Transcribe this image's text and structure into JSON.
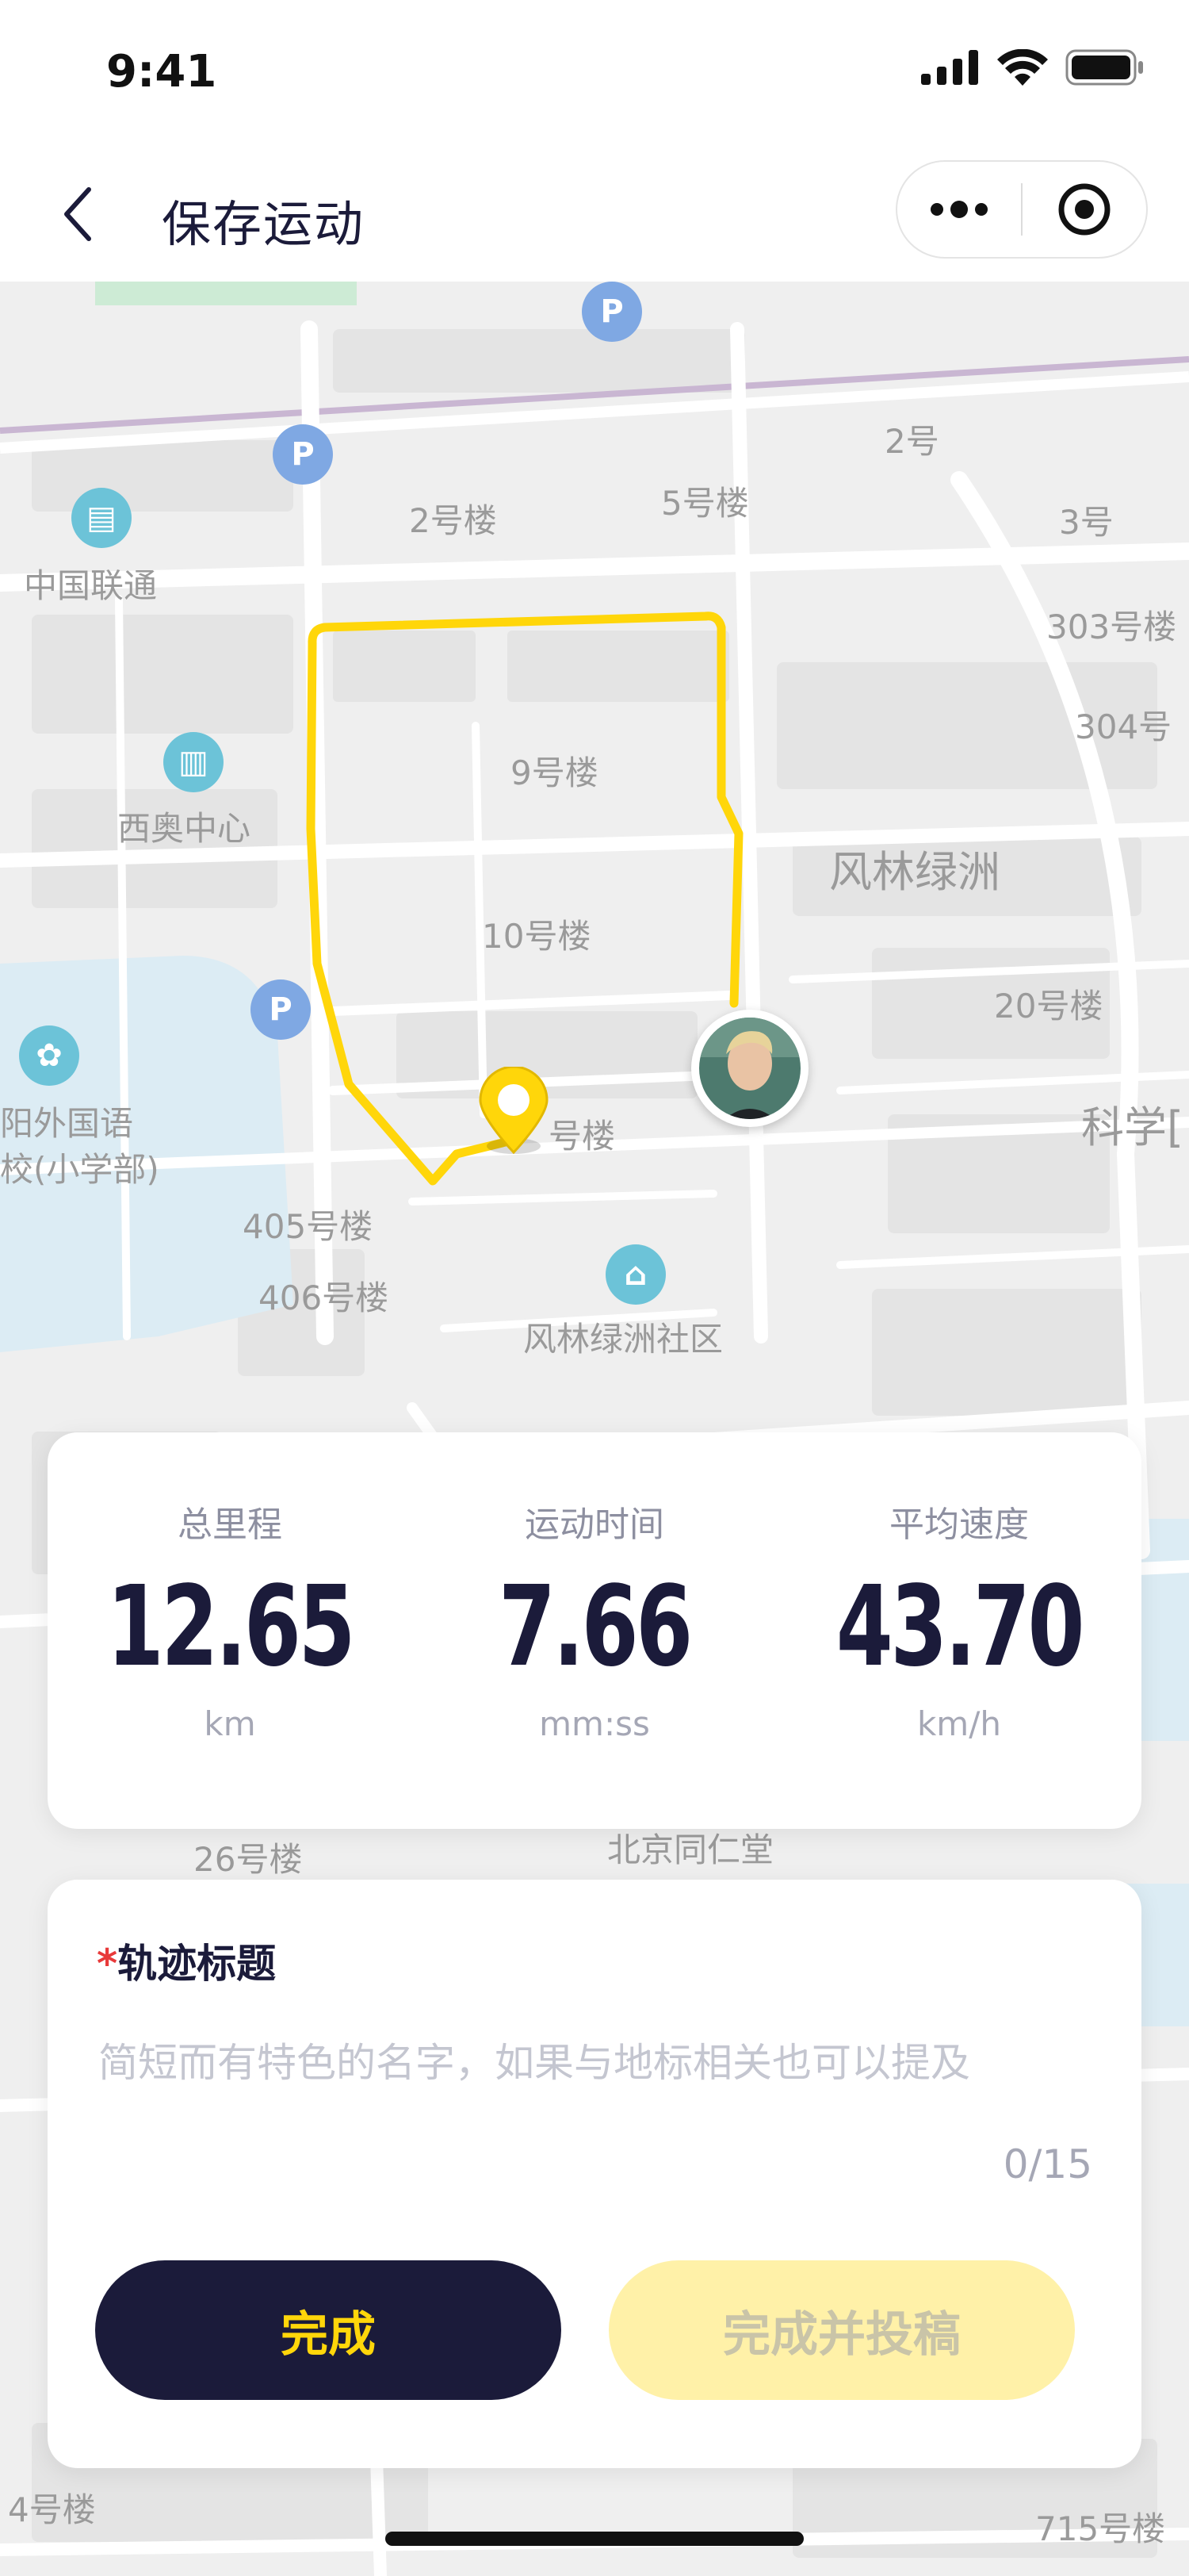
{
  "status_bar": {
    "time": "9:41"
  },
  "nav": {
    "title": "保存运动"
  },
  "map_labels": {
    "b2_top_right": "2号",
    "b2_left": "2号楼",
    "b5": "5号楼",
    "b3": "3号",
    "unicom": "中国联通",
    "b303": "303号楼",
    "b304": "304号",
    "b9": "9号楼",
    "xiao_center": "西奥中心",
    "fenglin_oasis": "风林绿洲",
    "b10": "10号楼",
    "b20": "20号楼",
    "school_line1": "阳外国语",
    "school_line2": "校(小学部)",
    "b_partial": "号楼",
    "science": "科学[",
    "b405": "405号楼",
    "b406": "406号楼",
    "community": "风林绿洲社区",
    "b26": "26号楼",
    "tongrentang": "北京同仁堂",
    "b4": "4号楼",
    "b715": "715号楼"
  },
  "stats": [
    {
      "label": "总里程",
      "value": "12.65",
      "unit": "km"
    },
    {
      "label": "运动时间",
      "value": "7.66",
      "unit": "mm:ss"
    },
    {
      "label": "平均速度",
      "value": "43.70",
      "unit": "km/h"
    }
  ],
  "form": {
    "required_mark": "*",
    "title_label": "轨迹标题",
    "title_placeholder": "简短而有特色的名字，如果与地标相关也可以提及",
    "title_value": "",
    "char_count": "0/15"
  },
  "buttons": {
    "done": "完成",
    "done_submit": "完成并投稿"
  },
  "colors": {
    "accent_yellow": "#ffd60a",
    "dark_navy": "#1b1b3a",
    "poi_blue": "#7fa8e3",
    "poi_teal": "#6cc3d8"
  }
}
